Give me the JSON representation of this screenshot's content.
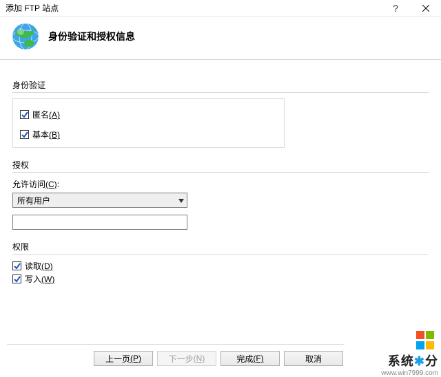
{
  "window": {
    "title": "添加 FTP 站点",
    "help_label": "?",
    "close_label": "×"
  },
  "header": {
    "heading": "身份验证和授权信息"
  },
  "auth": {
    "group_label": "身份验证",
    "anonymous": {
      "label": "匿名",
      "accel": "(A)",
      "checked": true
    },
    "basic": {
      "label": "基本",
      "accel": "(B)",
      "checked": true
    }
  },
  "authorize": {
    "group_label": "授权",
    "allow_access_label": "允许访问",
    "allow_access_accel": "(C)",
    "allow_access_colon": ":",
    "selected": "所有用户",
    "textbox_value": ""
  },
  "permissions": {
    "group_label": "权限",
    "read": {
      "label": "读取",
      "accel": "(D)",
      "checked": true
    },
    "write": {
      "label": "写入",
      "accel": "(W)",
      "checked": true
    }
  },
  "buttons": {
    "prev": {
      "label": "上一页",
      "accel": "(P)"
    },
    "next": {
      "label": "下一步",
      "accel": "(N)",
      "disabled": true
    },
    "finish": {
      "label": "完成",
      "accel": "(F)"
    },
    "cancel": {
      "label": "取消"
    }
  },
  "watermark": {
    "brand1": "系统",
    "brand2": "分",
    "url": "www.win7999.com"
  }
}
